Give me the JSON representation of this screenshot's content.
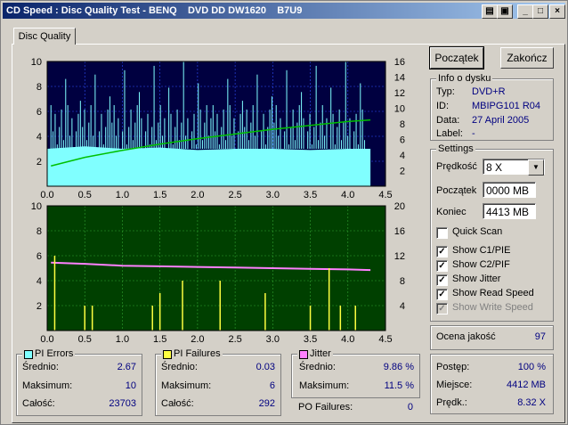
{
  "window": {
    "title": "CD Speed : Disc Quality Test - BENQ    DVD DD DW1620    B7U9",
    "min_glyph": "_",
    "max_glyph": "□",
    "close_glyph": "×",
    "extra1_glyph": "▤",
    "extra2_glyph": "▣"
  },
  "tab": {
    "label": "Disc Quality"
  },
  "buttons": {
    "start": "Początek",
    "end": "Zakończ"
  },
  "info": {
    "title": "Info o dysku",
    "type_label": "Typ:",
    "type_value": "DVD+R",
    "id_label": "ID:",
    "id_value": "MBIPG101 R04",
    "date_label": "Data:",
    "date_value": "27 April 2005",
    "label_label": "Label:",
    "label_value": "-"
  },
  "settings": {
    "title": "Settings",
    "speed_label": "Prędkość",
    "speed_value": "8 X",
    "start_label": "Początek",
    "start_value": "0000 MB",
    "end_label": "Koniec",
    "end_value": "4413 MB",
    "quick_scan": "Quick Scan",
    "show_c1": "Show C1/PIE",
    "show_c2": "Show C2/PIF",
    "show_jitter": "Show Jitter",
    "show_read": "Show Read Speed",
    "show_write": "Show Write Speed",
    "check_glyph": "✓"
  },
  "quality": {
    "label": "Ocena jakość",
    "value": "97"
  },
  "progress": {
    "progress_label": "Postęp:",
    "progress_value": "100 %",
    "place_label": "Miejsce:",
    "place_value": "4412 MB",
    "speed_label": "Prędk.:",
    "speed_value": "8.32 X"
  },
  "stats": {
    "pi_errors": {
      "title": "PI Errors",
      "avg_label": "Średnio:",
      "avg": "2.67",
      "max_label": "Maksimum:",
      "max": "10",
      "total_label": "Całość:",
      "total": "23703",
      "color": "#80ffff"
    },
    "pi_failures": {
      "title": "PI Failures",
      "avg_label": "Średnio:",
      "avg": "0.03",
      "max_label": "Maksimum:",
      "max": "6",
      "total_label": "Całość:",
      "total": "292",
      "color": "#ffff40"
    },
    "jitter": {
      "title": "Jitter",
      "avg_label": "Średnio:",
      "avg": "9.86 %",
      "max_label": "Maksimum:",
      "max": "11.5 %",
      "color": "#ff80ff"
    },
    "po_failures": {
      "label": "PO Failures:",
      "value": "0"
    }
  },
  "chart_data": [
    {
      "type": "area",
      "x_ticks": [
        "0.0",
        "0.5",
        "1.0",
        "1.5",
        "2.0",
        "2.5",
        "3.0",
        "3.5",
        "4.0",
        "4.5"
      ],
      "y_left_ticks": [
        "2",
        "4",
        "6",
        "8",
        "10"
      ],
      "y_right_ticks": [
        "2",
        "4",
        "6",
        "8",
        "10",
        "12",
        "14",
        "16"
      ],
      "xlim": [
        0,
        4.5
      ],
      "ylim_left": [
        0,
        10
      ],
      "ylim_right": [
        0,
        16
      ],
      "grid": true,
      "colors": {
        "background": "#000040",
        "pie": "#80ffff",
        "speed": "#00c000"
      },
      "series": [
        {
          "values_x": [
            0.0,
            0.5,
            1.0,
            1.5,
            2.0,
            2.5,
            3.0,
            3.5,
            4.0,
            4.3
          ],
          "values": [
            3.0,
            3.2,
            3.0,
            3.1,
            2.9,
            3.0,
            3.0,
            2.9,
            3.0,
            3.0
          ]
        },
        {
          "values_x": [
            0.05,
            0.5,
            1.0,
            1.5,
            2.0,
            2.5,
            3.0,
            3.5,
            4.0,
            4.3
          ],
          "values": [
            2.6,
            3.7,
            4.6,
            5.4,
            6.1,
            6.7,
            7.3,
            7.8,
            8.3,
            8.5
          ]
        }
      ]
    },
    {
      "type": "line",
      "x_ticks": [
        "0.0",
        "0.5",
        "1.0",
        "1.5",
        "2.0",
        "2.5",
        "3.0",
        "3.5",
        "4.0",
        "4.5"
      ],
      "y_left_ticks": [
        "2",
        "4",
        "6",
        "8",
        "10"
      ],
      "y_right_ticks": [
        "4",
        "8",
        "12",
        "16",
        "20"
      ],
      "xlim": [
        0,
        4.5
      ],
      "ylim_left": [
        0,
        10
      ],
      "ylim_right": [
        0,
        20
      ],
      "grid": true,
      "colors": {
        "background": "#004000",
        "pif": "#ffff40",
        "jitter": "#ff80ff"
      },
      "series": [
        {
          "values_x": [
            0.05,
            0.5,
            1.0,
            1.5,
            2.0,
            2.5,
            3.0,
            3.5,
            4.0,
            4.3
          ],
          "values": [
            10.9,
            10.7,
            10.4,
            10.3,
            10.2,
            10.1,
            10.0,
            9.9,
            9.8,
            9.7
          ]
        },
        {
          "values_x": [
            0.1,
            0.5,
            0.6,
            1.4,
            1.5,
            1.8,
            2.3,
            2.9,
            3.9,
            3.5,
            3.75,
            4.1
          ],
          "values": [
            6,
            2,
            2,
            2,
            3,
            4,
            4,
            3,
            2,
            2,
            5,
            2
          ]
        }
      ]
    }
  ]
}
